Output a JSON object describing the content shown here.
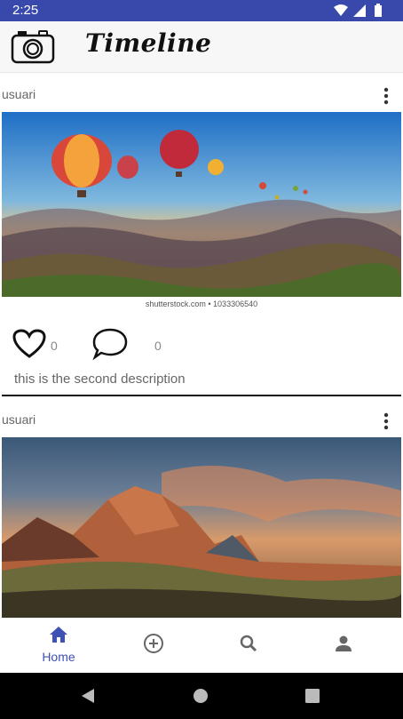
{
  "status_bar": {
    "time": "2:25",
    "icons": [
      "wifi-icon",
      "cell-signal-icon",
      "battery-icon"
    ]
  },
  "app_bar": {
    "logo_icon": "camera-icon",
    "title": "Timeline"
  },
  "posts": [
    {
      "user": "usuari",
      "image_watermark": "shutterstock.com • 1033306540",
      "likes": "0",
      "comments": "0",
      "description": "this is the second description"
    },
    {
      "user": "usuari"
    }
  ],
  "bottom_nav": {
    "items": [
      {
        "icon": "home-icon",
        "label": "Home",
        "active": true
      },
      {
        "icon": "add-circle-icon",
        "label": ""
      },
      {
        "icon": "search-icon",
        "label": ""
      },
      {
        "icon": "person-icon",
        "label": ""
      }
    ],
    "accent_color": "#3f51b5"
  },
  "colors": {
    "status_bar": "#3949ab",
    "app_bar": "#f7f7f7"
  }
}
